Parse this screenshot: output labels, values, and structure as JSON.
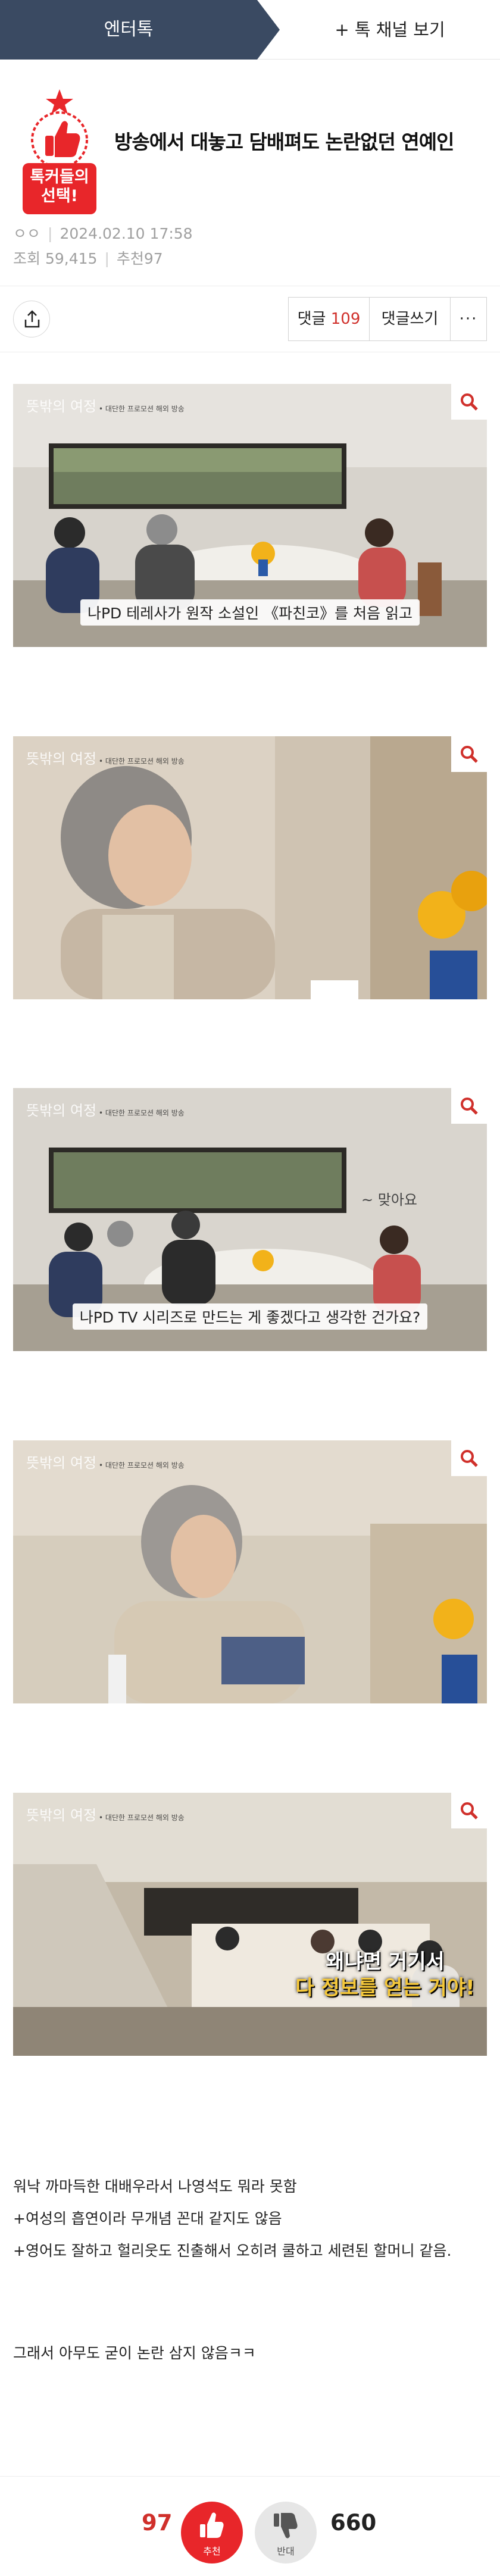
{
  "header": {
    "channel_tab": "엔터톡",
    "more_channels": "+ 톡 채널 보기"
  },
  "post": {
    "badge_line1": "톡커들의",
    "badge_line2": "선택!",
    "title": "방송에서 대놓고 담배펴도 논란없던 연예인",
    "author": "ㅇㅇ",
    "datetime": "2024.02.10 17:58",
    "views_label": "조회",
    "views": "59,415",
    "likes_label": "추천",
    "likes": "97"
  },
  "actions": {
    "comment_label": "댓글",
    "comment_count": "109",
    "write_label": "댓글쓰기",
    "more_label": "···"
  },
  "images": [
    {
      "watermark": "뜻밖의 여정",
      "sub": "• 대단한 프로모션 해외 방송",
      "caption": "나PD   테레사가 원작 소설인 《파친코》를 처음 읽고"
    },
    {
      "watermark": "뜻밖의 여정",
      "sub": "• 대단한 프로모션 해외 방송",
      "caption": ""
    },
    {
      "watermark": "뜻밖의 여정",
      "sub": "• 대단한 프로모션 해외 방송",
      "caption": "나PD   TV 시리즈로 만드는 게 좋겠다고 생각한 건가요?",
      "aside": "~ 맞아요"
    },
    {
      "watermark": "뜻밖의 여정",
      "sub": "• 대단한 프로모션 해외 방송",
      "caption": ""
    },
    {
      "watermark": "뜻밖의 여정",
      "sub": "• 대단한 프로모션 해외 방송",
      "caption": "",
      "overlay_line1": "왜냐면 거기서",
      "overlay_line2": "다 정보를 얻는 거야!"
    }
  ],
  "body": {
    "line1": "워낙 까마득한 대배우라서 나영석도 뭐라 못함",
    "line2": "+여성의 흡연이라 무개념 꼰대 같지도 않음",
    "line3": "+영어도 잘하고 헐리웃도 진출해서 오히려 쿨하고 세련된 할머니 같음.",
    "line4": "그래서 아무도 굳이 논란 삼지 않음ㅋㅋ"
  },
  "votes": {
    "up_count": "97",
    "up_label": "추천",
    "down_count": "660",
    "down_label": "반대"
  },
  "icons": [
    "share-icon",
    "zoom-icon",
    "thumbs-up-icon",
    "thumbs-down-icon",
    "star-icon"
  ],
  "colors": {
    "accent": "#d0302b",
    "channel": "#3a4a62",
    "vote_up": "#e8262a"
  }
}
